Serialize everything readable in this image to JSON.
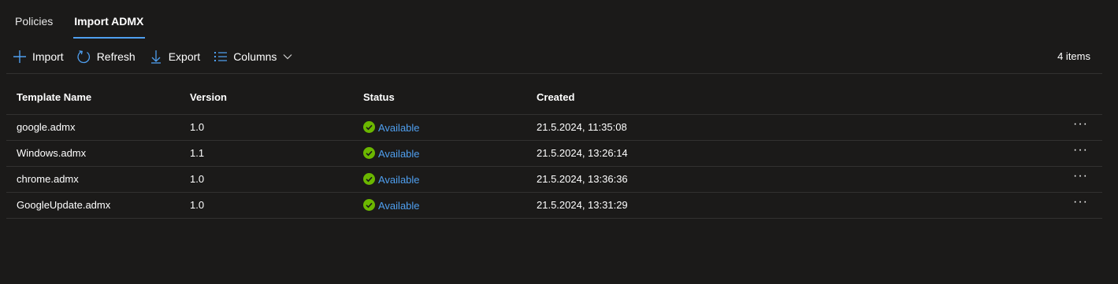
{
  "tabs": [
    {
      "label": "Policies"
    },
    {
      "label": "Import ADMX"
    }
  ],
  "toolbar": {
    "import_label": "Import",
    "refresh_label": "Refresh",
    "export_label": "Export",
    "columns_label": "Columns",
    "item_count": "4 items"
  },
  "table": {
    "headers": [
      "Template Name",
      "Version",
      "Status",
      "Created"
    ],
    "rows": [
      {
        "name": "google.admx",
        "version": "1.0",
        "status": "Available",
        "created": "21.5.2024, 11:35:08"
      },
      {
        "name": "Windows.admx",
        "version": "1.1",
        "status": "Available",
        "created": "21.5.2024, 13:26:14"
      },
      {
        "name": "chrome.admx",
        "version": "1.0",
        "status": "Available",
        "created": "21.5.2024, 13:36:36"
      },
      {
        "name": "GoogleUpdate.admx",
        "version": "1.0",
        "status": "Available",
        "created": "21.5.2024, 13:31:29"
      }
    ],
    "more_glyph": "···"
  },
  "colors": {
    "accent": "#4f9fef",
    "success": "#6bb700",
    "background": "#1b1a19"
  },
  "icons": {
    "import": "plus-icon",
    "refresh": "refresh-icon",
    "export": "download-arrow-icon",
    "columns": "list-columns-icon",
    "status": "checkmark-circle-icon"
  }
}
